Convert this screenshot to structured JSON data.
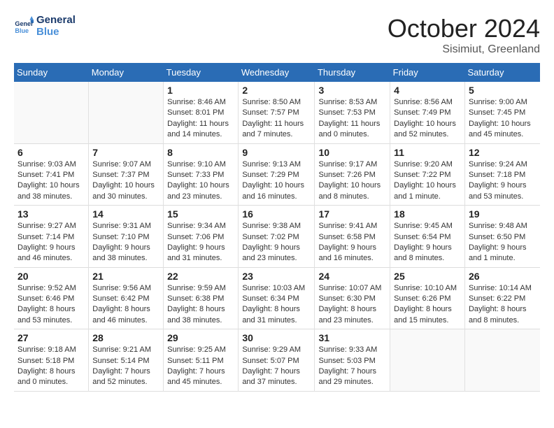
{
  "logo": {
    "line1": "General",
    "line2": "Blue"
  },
  "title": "October 2024",
  "location": "Sisimiut, Greenland",
  "weekdays": [
    "Sunday",
    "Monday",
    "Tuesday",
    "Wednesday",
    "Thursday",
    "Friday",
    "Saturday"
  ],
  "weeks": [
    [
      {
        "day": "",
        "content": ""
      },
      {
        "day": "",
        "content": ""
      },
      {
        "day": "1",
        "content": "Sunrise: 8:46 AM\nSunset: 8:01 PM\nDaylight: 11 hours\nand 14 minutes."
      },
      {
        "day": "2",
        "content": "Sunrise: 8:50 AM\nSunset: 7:57 PM\nDaylight: 11 hours\nand 7 minutes."
      },
      {
        "day": "3",
        "content": "Sunrise: 8:53 AM\nSunset: 7:53 PM\nDaylight: 11 hours\nand 0 minutes."
      },
      {
        "day": "4",
        "content": "Sunrise: 8:56 AM\nSunset: 7:49 PM\nDaylight: 10 hours\nand 52 minutes."
      },
      {
        "day": "5",
        "content": "Sunrise: 9:00 AM\nSunset: 7:45 PM\nDaylight: 10 hours\nand 45 minutes."
      }
    ],
    [
      {
        "day": "6",
        "content": "Sunrise: 9:03 AM\nSunset: 7:41 PM\nDaylight: 10 hours\nand 38 minutes."
      },
      {
        "day": "7",
        "content": "Sunrise: 9:07 AM\nSunset: 7:37 PM\nDaylight: 10 hours\nand 30 minutes."
      },
      {
        "day": "8",
        "content": "Sunrise: 9:10 AM\nSunset: 7:33 PM\nDaylight: 10 hours\nand 23 minutes."
      },
      {
        "day": "9",
        "content": "Sunrise: 9:13 AM\nSunset: 7:29 PM\nDaylight: 10 hours\nand 16 minutes."
      },
      {
        "day": "10",
        "content": "Sunrise: 9:17 AM\nSunset: 7:26 PM\nDaylight: 10 hours\nand 8 minutes."
      },
      {
        "day": "11",
        "content": "Sunrise: 9:20 AM\nSunset: 7:22 PM\nDaylight: 10 hours\nand 1 minute."
      },
      {
        "day": "12",
        "content": "Sunrise: 9:24 AM\nSunset: 7:18 PM\nDaylight: 9 hours\nand 53 minutes."
      }
    ],
    [
      {
        "day": "13",
        "content": "Sunrise: 9:27 AM\nSunset: 7:14 PM\nDaylight: 9 hours\nand 46 minutes."
      },
      {
        "day": "14",
        "content": "Sunrise: 9:31 AM\nSunset: 7:10 PM\nDaylight: 9 hours\nand 38 minutes."
      },
      {
        "day": "15",
        "content": "Sunrise: 9:34 AM\nSunset: 7:06 PM\nDaylight: 9 hours\nand 31 minutes."
      },
      {
        "day": "16",
        "content": "Sunrise: 9:38 AM\nSunset: 7:02 PM\nDaylight: 9 hours\nand 23 minutes."
      },
      {
        "day": "17",
        "content": "Sunrise: 9:41 AM\nSunset: 6:58 PM\nDaylight: 9 hours\nand 16 minutes."
      },
      {
        "day": "18",
        "content": "Sunrise: 9:45 AM\nSunset: 6:54 PM\nDaylight: 9 hours\nand 8 minutes."
      },
      {
        "day": "19",
        "content": "Sunrise: 9:48 AM\nSunset: 6:50 PM\nDaylight: 9 hours\nand 1 minute."
      }
    ],
    [
      {
        "day": "20",
        "content": "Sunrise: 9:52 AM\nSunset: 6:46 PM\nDaylight: 8 hours\nand 53 minutes."
      },
      {
        "day": "21",
        "content": "Sunrise: 9:56 AM\nSunset: 6:42 PM\nDaylight: 8 hours\nand 46 minutes."
      },
      {
        "day": "22",
        "content": "Sunrise: 9:59 AM\nSunset: 6:38 PM\nDaylight: 8 hours\nand 38 minutes."
      },
      {
        "day": "23",
        "content": "Sunrise: 10:03 AM\nSunset: 6:34 PM\nDaylight: 8 hours\nand 31 minutes."
      },
      {
        "day": "24",
        "content": "Sunrise: 10:07 AM\nSunset: 6:30 PM\nDaylight: 8 hours\nand 23 minutes."
      },
      {
        "day": "25",
        "content": "Sunrise: 10:10 AM\nSunset: 6:26 PM\nDaylight: 8 hours\nand 15 minutes."
      },
      {
        "day": "26",
        "content": "Sunrise: 10:14 AM\nSunset: 6:22 PM\nDaylight: 8 hours\nand 8 minutes."
      }
    ],
    [
      {
        "day": "27",
        "content": "Sunrise: 9:18 AM\nSunset: 5:18 PM\nDaylight: 8 hours\nand 0 minutes."
      },
      {
        "day": "28",
        "content": "Sunrise: 9:21 AM\nSunset: 5:14 PM\nDaylight: 7 hours\nand 52 minutes."
      },
      {
        "day": "29",
        "content": "Sunrise: 9:25 AM\nSunset: 5:11 PM\nDaylight: 7 hours\nand 45 minutes."
      },
      {
        "day": "30",
        "content": "Sunrise: 9:29 AM\nSunset: 5:07 PM\nDaylight: 7 hours\nand 37 minutes."
      },
      {
        "day": "31",
        "content": "Sunrise: 9:33 AM\nSunset: 5:03 PM\nDaylight: 7 hours\nand 29 minutes."
      },
      {
        "day": "",
        "content": ""
      },
      {
        "day": "",
        "content": ""
      }
    ]
  ]
}
